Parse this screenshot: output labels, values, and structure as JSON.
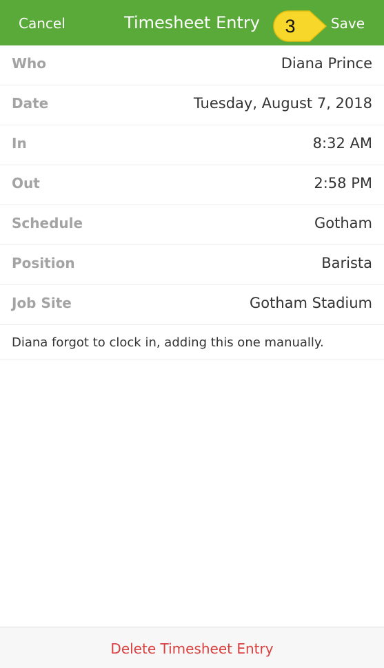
{
  "colors": {
    "nav_background": "#5aaa3a",
    "delete_text": "#d84040",
    "step_badge": "#f7d82a"
  },
  "navbar": {
    "cancel_label": "Cancel",
    "title": "Timesheet Entry",
    "save_label": "Save",
    "step_number": "3"
  },
  "fields": [
    {
      "label": "Who",
      "value": "Diana Prince"
    },
    {
      "label": "Date",
      "value": "Tuesday, August 7, 2018"
    },
    {
      "label": "In",
      "value": "8:32 AM"
    },
    {
      "label": "Out",
      "value": "2:58 PM"
    },
    {
      "label": "Schedule",
      "value": "Gotham"
    },
    {
      "label": "Position",
      "value": "Barista"
    },
    {
      "label": "Job Site",
      "value": "Gotham Stadium"
    }
  ],
  "note": "Diana forgot to clock in, adding this one manually.",
  "footer": {
    "delete_label": "Delete Timesheet Entry"
  }
}
